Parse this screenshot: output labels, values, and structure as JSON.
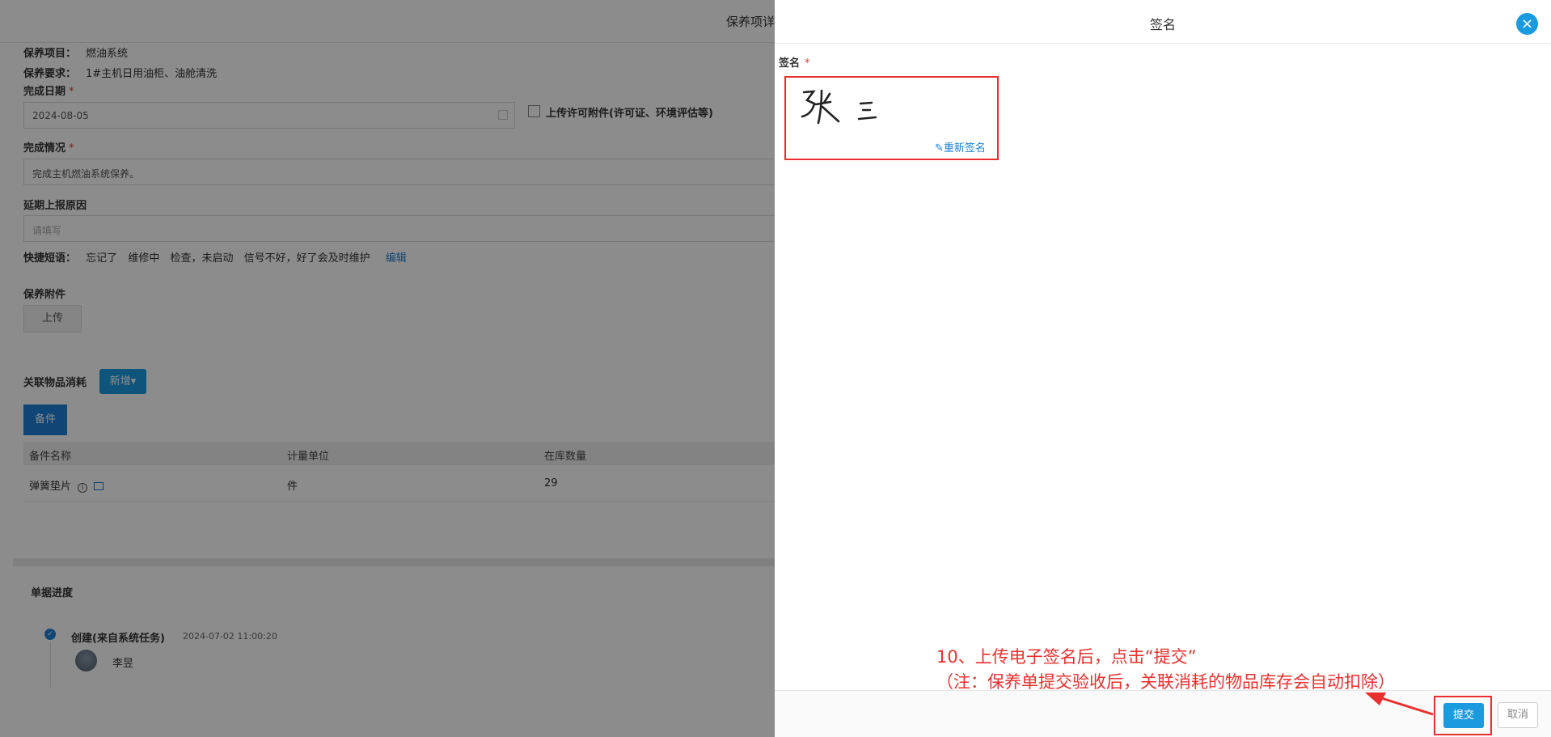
{
  "form": {
    "page_title": "保养项详",
    "item_label": "保养项目：",
    "item_value": "燃油系统",
    "req_label": "保养要求：",
    "req_value": "1#主机日用油柜、油舱清洗",
    "date_label": "完成日期",
    "required_mark": "*",
    "date_value": "2024-08-05",
    "permit_label": "上传许可附件(许可证、环境评估等)",
    "status_label": "完成情况",
    "status_value": "完成主机燃油系统保养。",
    "delay_label": "延期上报原因",
    "delay_placeholder": "请填写",
    "phrases_label": "快捷短语：",
    "phrases": [
      "忘记了",
      "维修中",
      "检查，未启动",
      "信号不好，好了会及时维护"
    ],
    "phrases_edit": "编辑",
    "attach_label": "保养附件",
    "upload_button": "上传",
    "related_label": "关联物品消耗",
    "new_button": "新增▾",
    "parts_tab": "备件",
    "table_headers": [
      "备件名称",
      "计量单位",
      "在库数量"
    ],
    "table_rows": [
      {
        "name": "弹簧垫片",
        "unit": "件",
        "qty": "29"
      }
    ],
    "progress_label": "单据进度",
    "timeline_title": "创建(来自系统任务)",
    "timeline_time": "2024-07-02 11:00:20",
    "timeline_user": "李昱"
  },
  "panel": {
    "title": "签名",
    "close_icon": "×",
    "signature_label": "签名",
    "required_mark": "*",
    "signature_handwriting": "张三",
    "resign_link": "重新签名",
    "annotation_line1": "10、上传电子签名后，点击“提交”",
    "annotation_line2": "（注：保养单提交验收后，关联消耗的物品库存会自动扣除）",
    "submit_button": "提交",
    "cancel_button": "取消",
    "accent_color": "#1b9ae0",
    "annotation_color": "#e8302e"
  }
}
